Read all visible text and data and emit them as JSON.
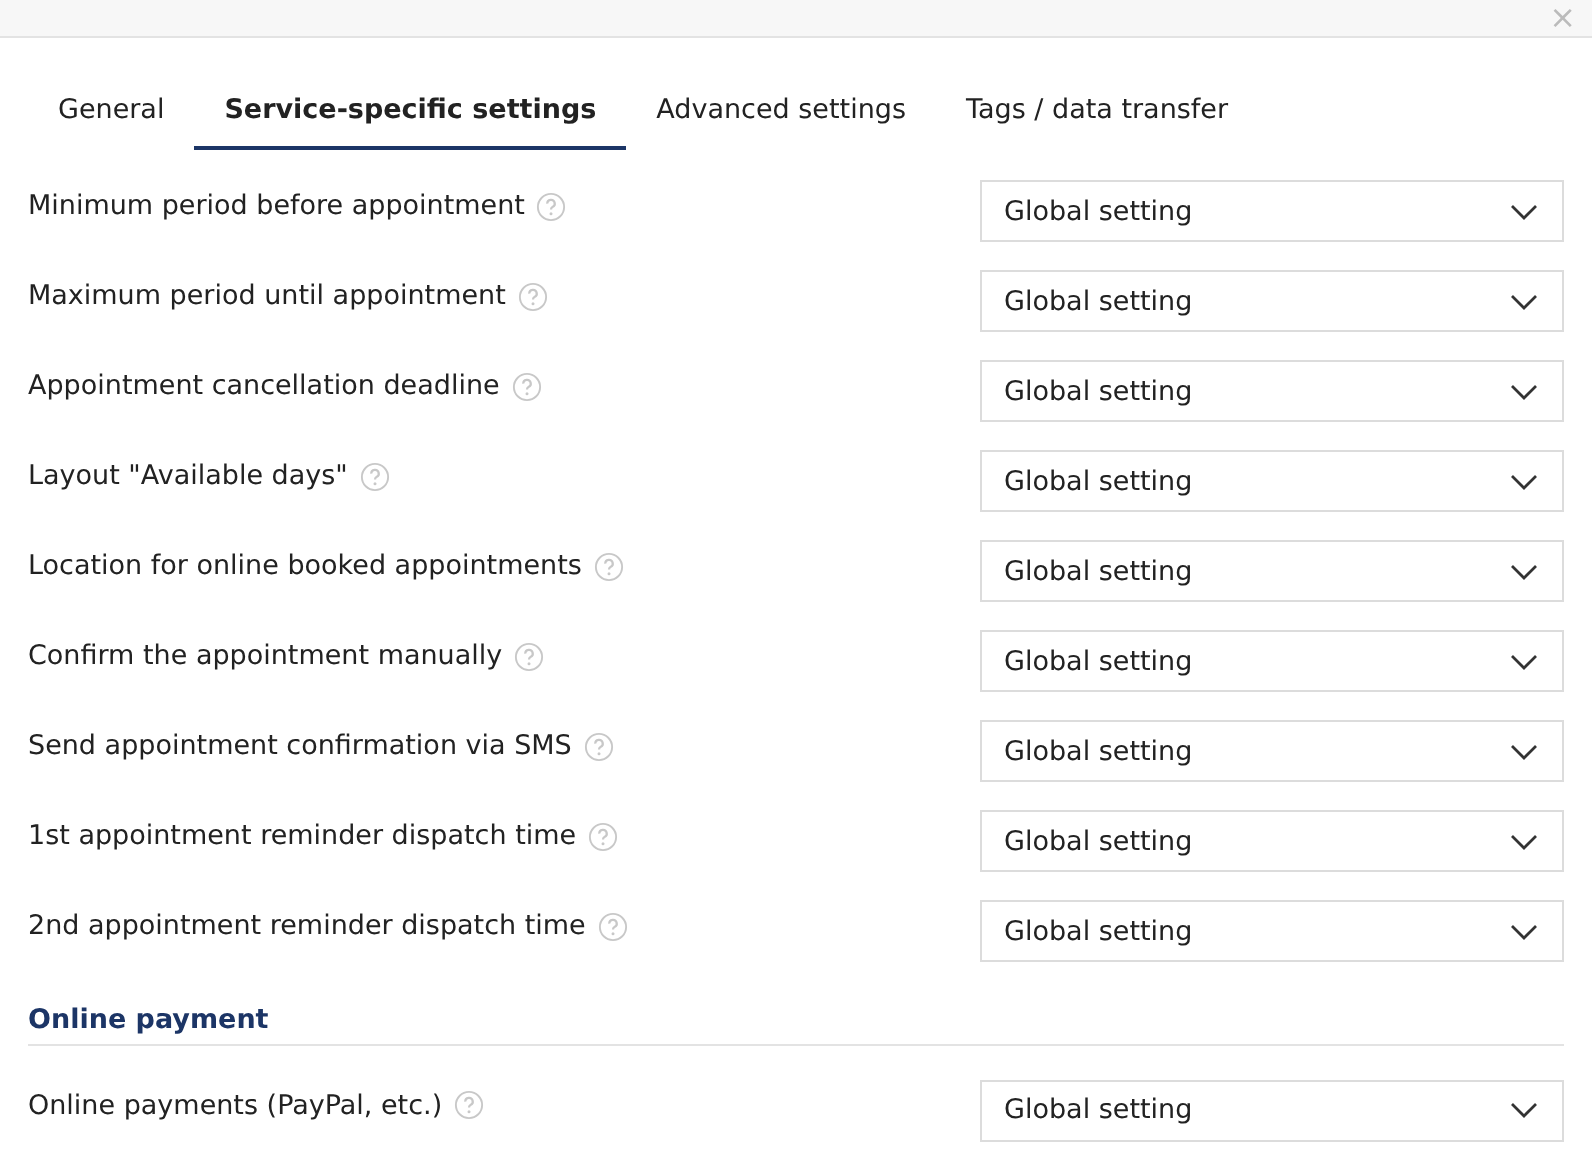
{
  "close_button": "×",
  "tabs": [
    {
      "label": "General",
      "selected": false
    },
    {
      "label": "Service-specific settings",
      "selected": true
    },
    {
      "label": "Advanced settings",
      "selected": false
    },
    {
      "label": "Tags / data transfer",
      "selected": false
    }
  ],
  "settings": [
    {
      "label": "Minimum period before appointment",
      "value": "Global setting"
    },
    {
      "label": "Maximum period until appointment",
      "value": "Global setting"
    },
    {
      "label": "Appointment cancellation deadline",
      "value": "Global setting"
    },
    {
      "label": "Layout \"Available days\"",
      "value": "Global setting"
    },
    {
      "label": "Location for online booked appointments",
      "value": "Global setting"
    },
    {
      "label": "Confirm the appointment manually",
      "value": "Global setting"
    },
    {
      "label": "Send appointment confirmation via SMS",
      "value": "Global setting"
    },
    {
      "label": "1st appointment reminder dispatch time",
      "value": "Global setting"
    },
    {
      "label": "2nd appointment reminder dispatch time",
      "value": "Global setting"
    }
  ],
  "online_payment": {
    "title": "Online payment",
    "settings": [
      {
        "label": "Online payments (PayPal, etc.)",
        "value": "Global setting"
      }
    ]
  }
}
